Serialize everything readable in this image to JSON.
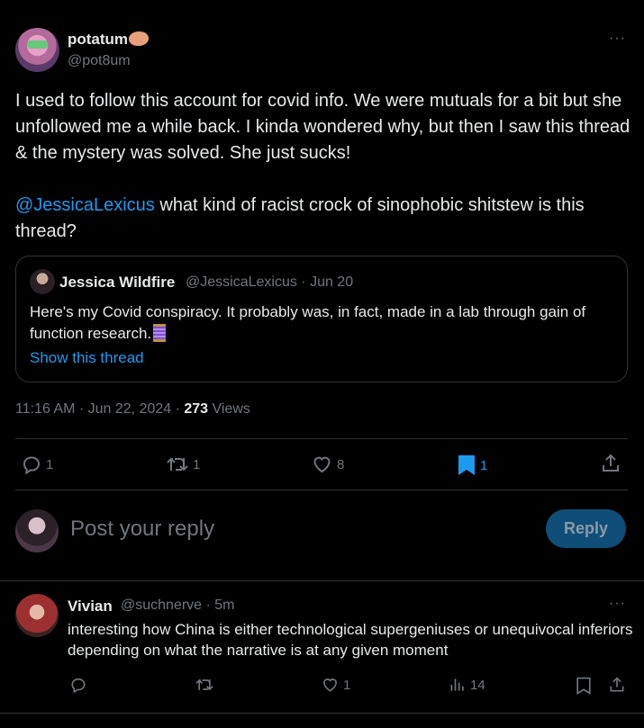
{
  "tweet": {
    "author": {
      "display_name": "potatum",
      "handle": "@pot8um",
      "name_emoji": "potato-emoji"
    },
    "paragraphs": [
      "I used to follow this account for covid info. We were mutuals for a bit but she unfollowed me a while back. I kinda wondered why, but then I saw this thread & the mystery was solved. She just sucks!"
    ],
    "mention": "@JessicaLexicus",
    "mention_tail": " what kind of racist crock of sinophobic shitstew is this thread?",
    "more_label": "···",
    "timestamp": "11:16 AM · Jun 22, 2024 · ",
    "views_count": "273",
    "views_label": " Views"
  },
  "quote": {
    "display_name": "Jessica Wildfire",
    "meta": "@JessicaLexicus · Jun 20",
    "text": "Here's my Covid conspiracy. It probably was, in fact, made in a lab through gain of function research.",
    "emoji": "thread-spool-emoji",
    "show_thread": "Show this thread"
  },
  "actions": {
    "replies": "1",
    "reposts": "1",
    "likes": "8",
    "bookmarks": "1"
  },
  "composer": {
    "placeholder": "Post your reply",
    "button": "Reply"
  },
  "reply": {
    "display_name": "Vivian",
    "meta": "@suchnerve · 5m",
    "text": "interesting how China is either technological supergeniuses or unequivocal inferiors depending on what the narrative is at any given moment",
    "likes": "1",
    "views": "14",
    "more_label": "···"
  },
  "colors": {
    "background": "#000000",
    "text": "#e7e9ea",
    "muted": "#71767b",
    "link": "#1d9bf0",
    "border": "#2f3336",
    "reply_button": "#0f4e78"
  }
}
